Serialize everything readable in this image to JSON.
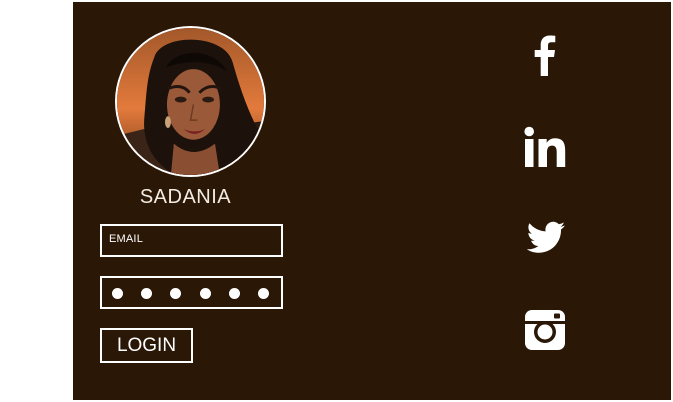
{
  "profile": {
    "username": "SADANIA",
    "avatar_icon": "user-avatar"
  },
  "form": {
    "email_placeholder": "EMAIL",
    "password_mask_count": 6,
    "login_label": "LOGIN"
  },
  "social": [
    {
      "name": "facebook",
      "icon": "facebook-icon"
    },
    {
      "name": "linkedin",
      "icon": "linkedin-icon"
    },
    {
      "name": "twitter",
      "icon": "twitter-icon"
    },
    {
      "name": "instagram",
      "icon": "instagram-icon"
    }
  ],
  "colors": {
    "panel_background": "#2a1706",
    "page_background": "#ffffff",
    "foreground": "#ffffff"
  }
}
